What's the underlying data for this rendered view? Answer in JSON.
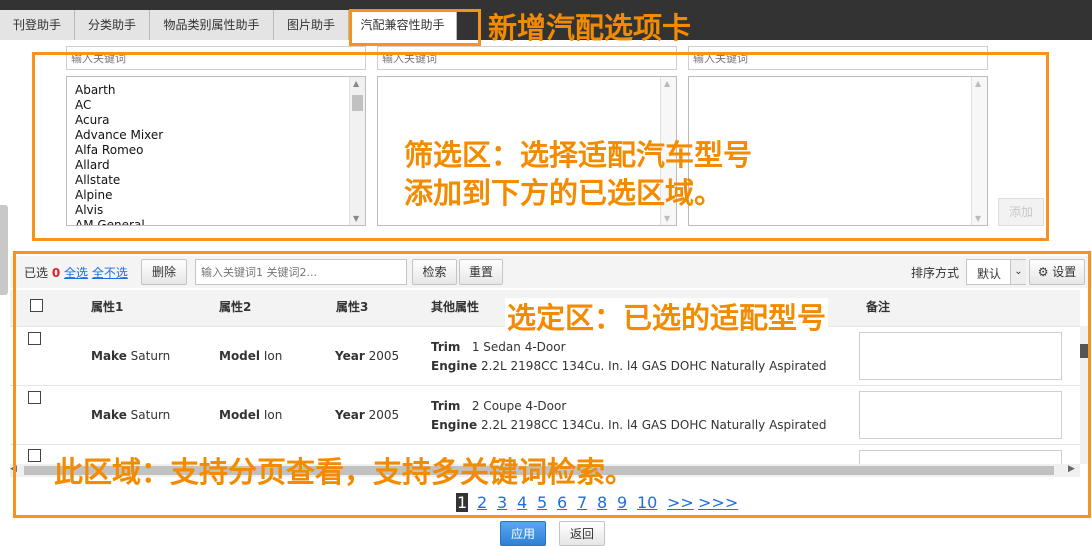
{
  "tabs": [
    {
      "label": "刊登助手"
    },
    {
      "label": "分类助手"
    },
    {
      "label": "物品类别属性助手"
    },
    {
      "label": "图片助手"
    },
    {
      "label": "汽配兼容性助手"
    }
  ],
  "annotations": {
    "tab_note": "新增汽配选项卡",
    "filter_note_line1": "筛选区：选择适配汽车型号",
    "filter_note_line2": "添加到下方的已选区域。",
    "selected_note": "选定区：已选的适配型号",
    "paging_note": "此区域：支持分页查看，支持多关键词检索。"
  },
  "filter": {
    "placeholder": "输入关键词",
    "makes": [
      "Abarth",
      "AC",
      "Acura",
      "Advance Mixer",
      "Alfa Romeo",
      "Allard",
      "Allstate",
      "Alpine",
      "Alvis",
      "AM General"
    ],
    "add_label": "添加"
  },
  "toolbar": {
    "selected_label": "已选",
    "selected_count": "0",
    "select_all": "全选",
    "select_none": "全不选",
    "delete_label": "删除",
    "search_placeholder": "输入关键词1 关键词2...",
    "search_label": "检索",
    "reset_label": "重置",
    "sort_label": "排序方式",
    "sort_value": "默认",
    "settings_label": "设置"
  },
  "table": {
    "headers": [
      "属性1",
      "属性2",
      "属性3",
      "其他属性",
      "备注"
    ],
    "rows": [
      {
        "make_k": "Make",
        "make_v": "Saturn",
        "model_k": "Model",
        "model_v": "Ion",
        "year_k": "Year",
        "year_v": "2005",
        "trim_k": "Trim",
        "trim_v": "1 Sedan 4-Door",
        "engine_k": "Engine",
        "engine_v": "2.2L 2198CC 134Cu. In. l4 GAS DOHC Naturally Aspirated"
      },
      {
        "make_k": "Make",
        "make_v": "Saturn",
        "model_k": "Model",
        "model_v": "Ion",
        "year_k": "Year",
        "year_v": "2005",
        "trim_k": "Trim",
        "trim_v": "2 Coupe 4-Door",
        "engine_k": "Engine",
        "engine_v": "2.2L 2198CC 134Cu. In. l4 GAS DOHC Naturally Aspirated"
      }
    ]
  },
  "pagination": {
    "pages": [
      "1",
      "2",
      "3",
      "4",
      "5",
      "6",
      "7",
      "8",
      "9",
      "10"
    ],
    "next": ">>",
    "last": ">>>",
    "current": "1"
  },
  "footer": {
    "apply_label": "应用",
    "back_label": "返回"
  },
  "colors": {
    "annotation": "#f28b00",
    "link": "#1f6ee0",
    "apply": "#3d8fe0"
  }
}
